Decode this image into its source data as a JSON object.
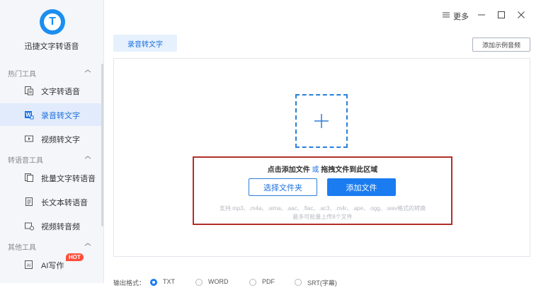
{
  "app": {
    "logo_letter": "T",
    "name": "迅捷文字转语音"
  },
  "sidebar": {
    "sections": [
      {
        "title": "热门工具",
        "items": [
          {
            "label": "文字转语音",
            "icon": "text-doc-icon"
          },
          {
            "label": "录音转文字",
            "icon": "word-doc-icon",
            "active": true
          },
          {
            "label": "视频转文字",
            "icon": "video-icon"
          }
        ]
      },
      {
        "title": "转语音工具",
        "items": [
          {
            "label": "批量文字转语音",
            "icon": "batch-doc-icon"
          },
          {
            "label": "长文本转语音",
            "icon": "long-doc-icon"
          },
          {
            "label": "视频转音频",
            "icon": "video-audio-icon"
          }
        ]
      },
      {
        "title": "其他工具",
        "items": [
          {
            "label": "AI写作",
            "icon": "ai-write-icon",
            "badge": "HOT"
          }
        ]
      }
    ]
  },
  "titlebar": {
    "more_label": "更多"
  },
  "tabs": [
    {
      "label": "录音转文字",
      "active": true
    }
  ],
  "example_button": "添加示例音频",
  "upload": {
    "hint_prefix": "点击添加文件",
    "hint_or": "或",
    "hint_suffix": "拖拽文件到此区域",
    "select_folder_button": "选择文件夹",
    "add_file_button": "添加文件",
    "formats_text": "支持.mp3、.m4a、.wma、.aac、.flac、.ac3、.m4r、.ape、.ogg、.wav格式的转换",
    "batch_text": "最多可批量上传8个文件"
  },
  "output": {
    "label": "输出格式：",
    "options": [
      "TXT",
      "WORD",
      "PDF",
      "SRT(字幕)"
    ],
    "selected": "TXT"
  },
  "colors": {
    "accent": "#1a7cf0",
    "highlight_border": "#b0302a",
    "hot_badge": "#ff4d3a"
  }
}
